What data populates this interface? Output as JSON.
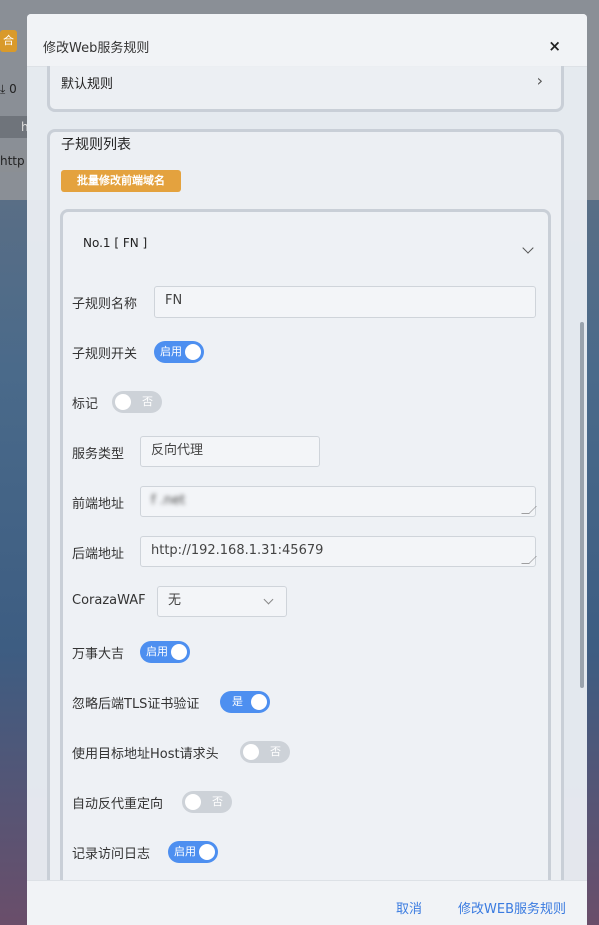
{
  "background": {
    "button_label": "合",
    "download_text": "0",
    "row_text": "h",
    "url_text": "http"
  },
  "modal": {
    "title": "修改Web服务规则",
    "close_label": "×",
    "default_rule_label": "默认规则",
    "sub_rule_section_title": "子规则列表",
    "batch_edit_button": "批量修改前端域名",
    "rule_header": "No.1 [ FN ]",
    "fields": {
      "name_label": "子规则名称",
      "name_value": "FN",
      "switch_label": "子规则开关",
      "switch_state": "启用",
      "mark_label": "标记",
      "mark_state": "否",
      "service_type_label": "服务类型",
      "service_type_value": "反向代理",
      "frontend_label": "前端地址",
      "frontend_value": "f          .net",
      "backend_label": "后端地址",
      "backend_value": "http://192.168.1.31:45679",
      "waf_label": "CorazaWAF",
      "waf_value": "无",
      "lucky_label": "万事大吉",
      "lucky_state": "启用",
      "ignore_tls_label": "忽略后端TLS证书验证",
      "ignore_tls_state": "是",
      "use_host_label": "使用目标地址Host请求头",
      "use_host_state": "否",
      "auto_redirect_label": "自动反代重定向",
      "auto_redirect_state": "否",
      "access_log_label": "记录访问日志",
      "access_log_state": "启用"
    },
    "footer": {
      "cancel": "取消",
      "submit": "修改WEB服务规则"
    }
  },
  "colors": {
    "accent": "#4d8ff0",
    "batch_button": "#e4a23e",
    "link": "#3a7be0"
  }
}
